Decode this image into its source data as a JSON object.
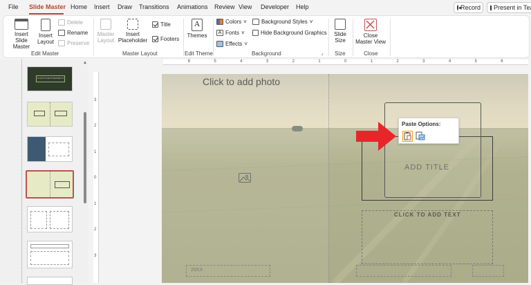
{
  "menu": {
    "tabs": [
      "File",
      "Slide Master",
      "Home",
      "Insert",
      "Draw",
      "Transitions",
      "Animations",
      "Review",
      "View",
      "Developer",
      "Help"
    ],
    "active_tab": "Slide Master",
    "record_label": "Record",
    "present_label": "Present in Tea"
  },
  "ribbon": {
    "edit_master": {
      "label": "Edit Master",
      "insert_slide_master": "Insert Slide Master",
      "insert_layout": "Insert Layout",
      "delete": "Delete",
      "rename": "Rename",
      "preserve": "Preserve"
    },
    "master_layout": {
      "label": "Master Layout",
      "master_layout_btn": "Master Layout",
      "insert_placeholder": "Insert Placeholder",
      "title_chk": "Title",
      "footers_chk": "Footers",
      "title_checked": true,
      "footers_checked": true
    },
    "edit_theme": {
      "label": "Edit Theme",
      "themes": "Themes"
    },
    "background": {
      "label": "Background",
      "colors": "Colors",
      "fonts": "Fonts",
      "effects": "Effects",
      "background_styles": "Background Styles",
      "hide_background_graphics": "Hide Background Graphics",
      "hide_checked": false
    },
    "size": {
      "label": "Size",
      "slide_size": "Slide Size"
    },
    "close": {
      "label": "Close",
      "close_master_view": "Close Master View"
    }
  },
  "ruler": {
    "h_numbers": [
      "6",
      "5",
      "4",
      "3",
      "2",
      "1",
      "0",
      "1",
      "2",
      "3",
      "4",
      "5",
      "6"
    ],
    "v_numbers": [
      "3",
      "2",
      "1",
      "0",
      "1",
      "2",
      "3"
    ]
  },
  "slide": {
    "photo_placeholder": "Click to add photo",
    "title_placeholder": "ADD TITLE",
    "text_placeholder": "CLICK TO ADD TEXT",
    "date_placeholder": "20XX"
  },
  "paste_options": {
    "title": "Paste Options:"
  },
  "thumbnails": {
    "selected_index": 3,
    "first_thumb_text": "CLICK TO EDIT MASTER TITLE"
  }
}
